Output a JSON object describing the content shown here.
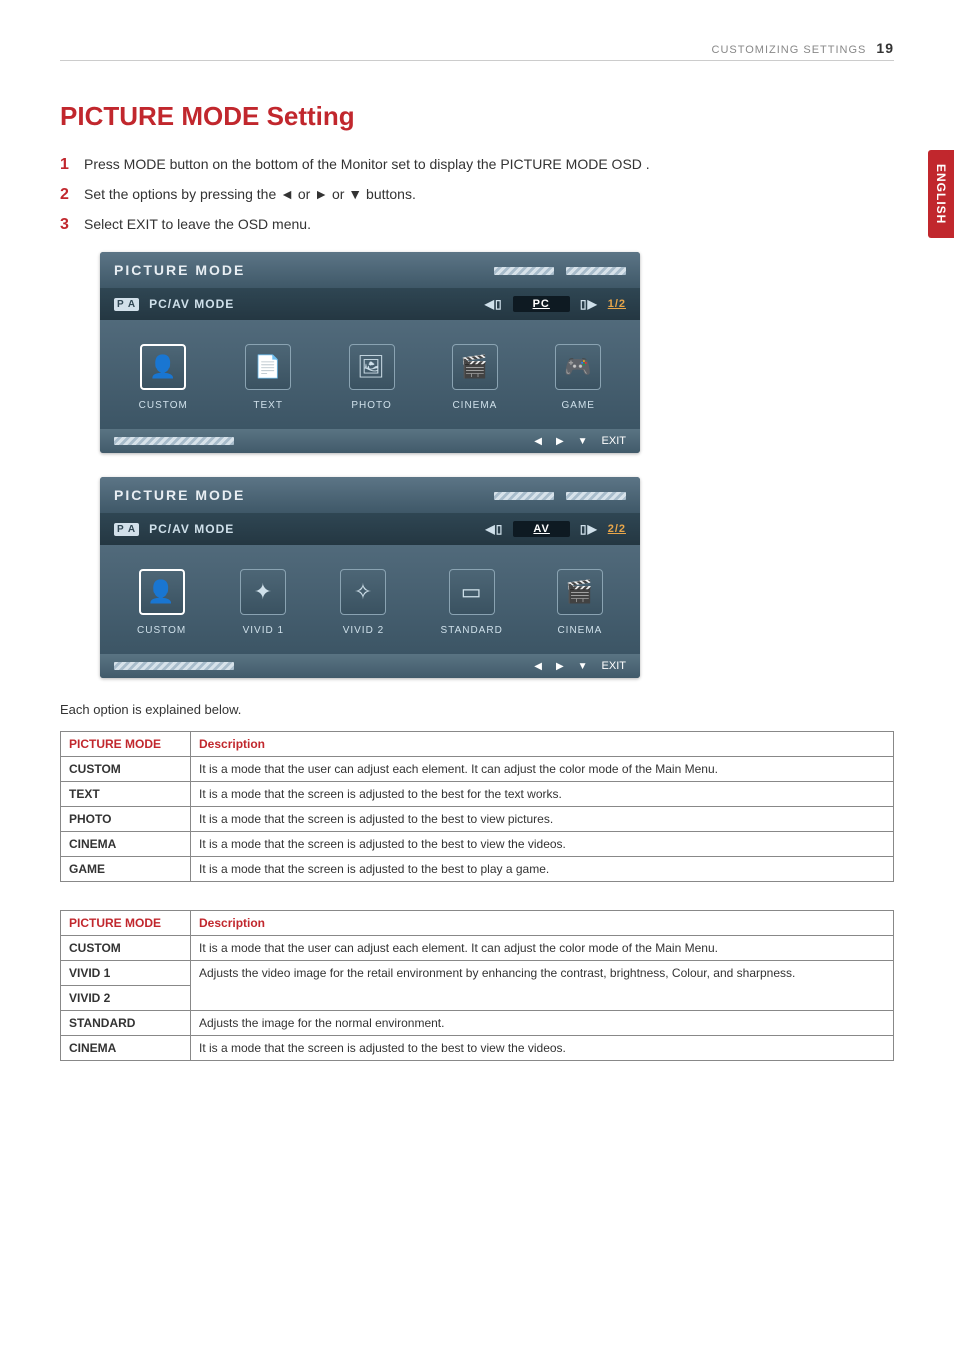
{
  "header": {
    "section": "CUSTOMIZING SETTINGS",
    "page": "19"
  },
  "sideTab": "ENGLISH",
  "title": "PICTURE MODE Setting",
  "steps": [
    "Press MODE button on the bottom of the Monitor set to display the PICTURE MODE OSD .",
    "Set the options by pressing the ◄ or ► or ▼ buttons.",
    "Select EXIT to leave the OSD menu."
  ],
  "osd1": {
    "title": "PICTURE  MODE",
    "rowLabel": "PC/AV  MODE",
    "paBadge": "P A",
    "value": "PC",
    "page": "1/2",
    "tiles": [
      {
        "icon": "👤",
        "label": "CUSTOM",
        "name": "custom-icon",
        "active": true
      },
      {
        "icon": "📄",
        "label": "TEXT",
        "name": "text-icon"
      },
      {
        "icon": "🖼",
        "label": "PHOTO",
        "name": "photo-icon"
      },
      {
        "icon": "🎬",
        "label": "CINEMA",
        "name": "cinema-icon"
      },
      {
        "icon": "🎮",
        "label": "GAME",
        "name": "game-icon"
      }
    ],
    "exit": "EXIT"
  },
  "osd2": {
    "title": "PICTURE  MODE",
    "rowLabel": "PC/AV  MODE",
    "paBadge": "P A",
    "value": "AV",
    "page": "2/2",
    "tiles": [
      {
        "icon": "👤",
        "label": "CUSTOM",
        "name": "custom-icon",
        "active": true
      },
      {
        "icon": "✦",
        "label": "VIVID 1",
        "name": "vivid1-icon"
      },
      {
        "icon": "✧",
        "label": "VIVID 2",
        "name": "vivid2-icon"
      },
      {
        "icon": "▭",
        "label": "STANDARD",
        "name": "standard-icon"
      },
      {
        "icon": "🎬",
        "label": "CINEMA",
        "name": "cinema-icon"
      }
    ],
    "exit": "EXIT"
  },
  "explain": "Each option is explained below.",
  "table1": {
    "headMode": "PICTURE MODE",
    "headDesc": "Description",
    "rows": [
      {
        "mode": "CUSTOM",
        "desc": "It is a mode that the user can adjust each element. It can adjust the color mode of the Main Menu."
      },
      {
        "mode": "TEXT",
        "desc": "It is a mode that the screen is adjusted to the best for the text works."
      },
      {
        "mode": "PHOTO",
        "desc": "It is a mode that the screen is adjusted to the best to view pictures."
      },
      {
        "mode": "CINEMA",
        "desc": "It is a mode that the screen is adjusted to the best to view the videos."
      },
      {
        "mode": "GAME",
        "desc": "It is a mode that the screen is adjusted to the best to play a game."
      }
    ]
  },
  "table2": {
    "headMode": "PICTURE MODE",
    "headDesc": "Description",
    "rows": [
      {
        "mode": "CUSTOM",
        "desc": "It is a mode that the user can adjust each element. It can adjust the color mode of the Main Menu."
      },
      {
        "mode": "VIVID 1",
        "desc": "Adjusts the video image for the retail environment by enhancing the contrast, brightness, Colour, and sharpness.",
        "merge": true
      },
      {
        "mode": "VIVID 2",
        "desc": "",
        "merged": true
      },
      {
        "mode": "STANDARD",
        "desc": "Adjusts the image for the normal environment."
      },
      {
        "mode": "CINEMA",
        "desc": "It is a mode that the screen is adjusted to the best to view the videos."
      }
    ]
  }
}
